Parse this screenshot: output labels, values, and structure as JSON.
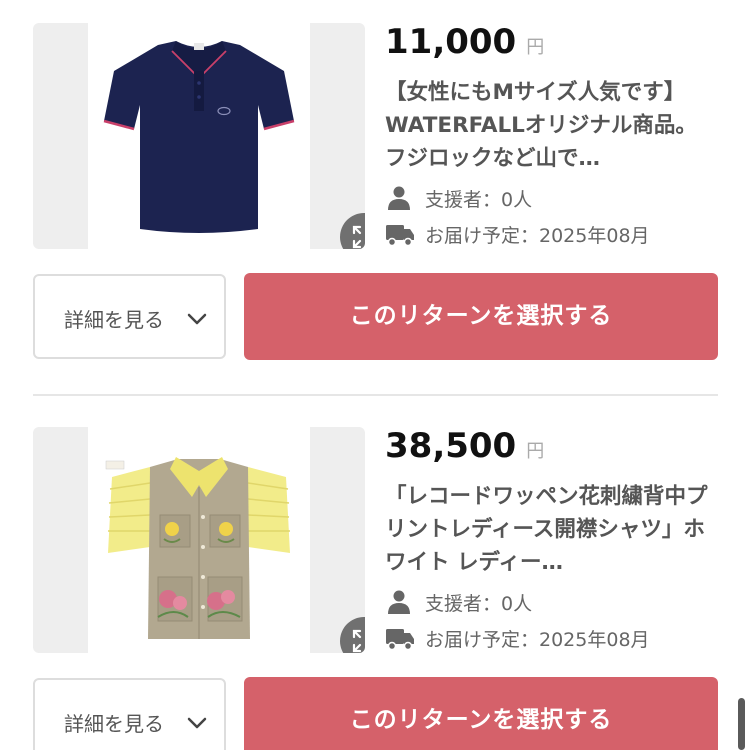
{
  "rewards": [
    {
      "price": "11,000",
      "currency": "円",
      "title": "【女性にもMサイズ人気です】 WATERFALLオリジナル商品。フジロックなど山で…",
      "backers_label": "支援者：0人",
      "delivery_label": "お届け予定：2025年08月",
      "detail_button": "詳細を見る",
      "select_button": "このリターンを選択する",
      "image": "navy-polo-shirt"
    },
    {
      "price": "38,500",
      "currency": "円",
      "title": "「レコードワッペン花刺繍背中プリントレディース開襟シャツ」ホワイト レディー…",
      "backers_label": "支援者：0人",
      "delivery_label": "お届け予定：2025年08月",
      "detail_button": "詳細を見る",
      "select_button": "このリターンを選択する",
      "image": "embroidered-open-collar-shirt"
    }
  ],
  "icons": {
    "expand": "expand-icon",
    "person": "person-icon",
    "truck": "truck-icon",
    "chevron": "chevron-down-icon"
  },
  "colors": {
    "accent": "#d5616a",
    "price": "#111111",
    "title": "#555555",
    "meta": "#666666"
  }
}
